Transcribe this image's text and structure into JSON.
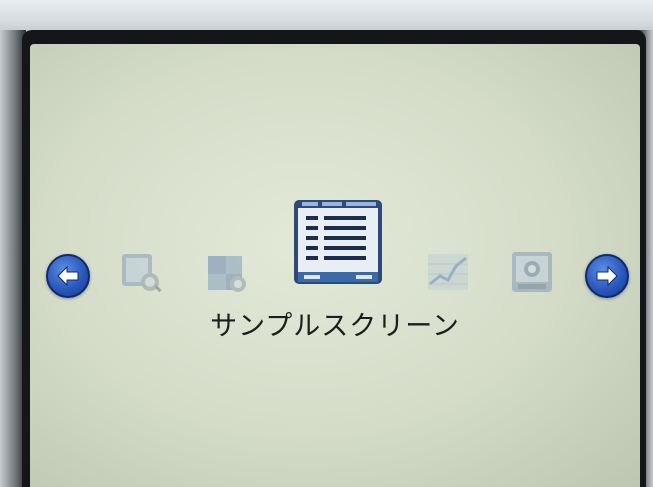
{
  "menu": {
    "selected_label": "サンプルスクリーン",
    "items": [
      {
        "icon": "zoom-icon",
        "selected": false
      },
      {
        "icon": "puzzle-icon",
        "selected": false
      },
      {
        "icon": "sample-screen-icon",
        "selected": true
      },
      {
        "icon": "chart-icon",
        "selected": false
      },
      {
        "icon": "scan-icon",
        "selected": false
      }
    ],
    "nav": {
      "prev_icon": "arrow-left-icon",
      "next_icon": "arrow-right-icon"
    }
  },
  "colors": {
    "screen_bg": "#d4dcc8",
    "arrow_blue": "#2654b8",
    "icon_frame": "#2c4a7a"
  }
}
